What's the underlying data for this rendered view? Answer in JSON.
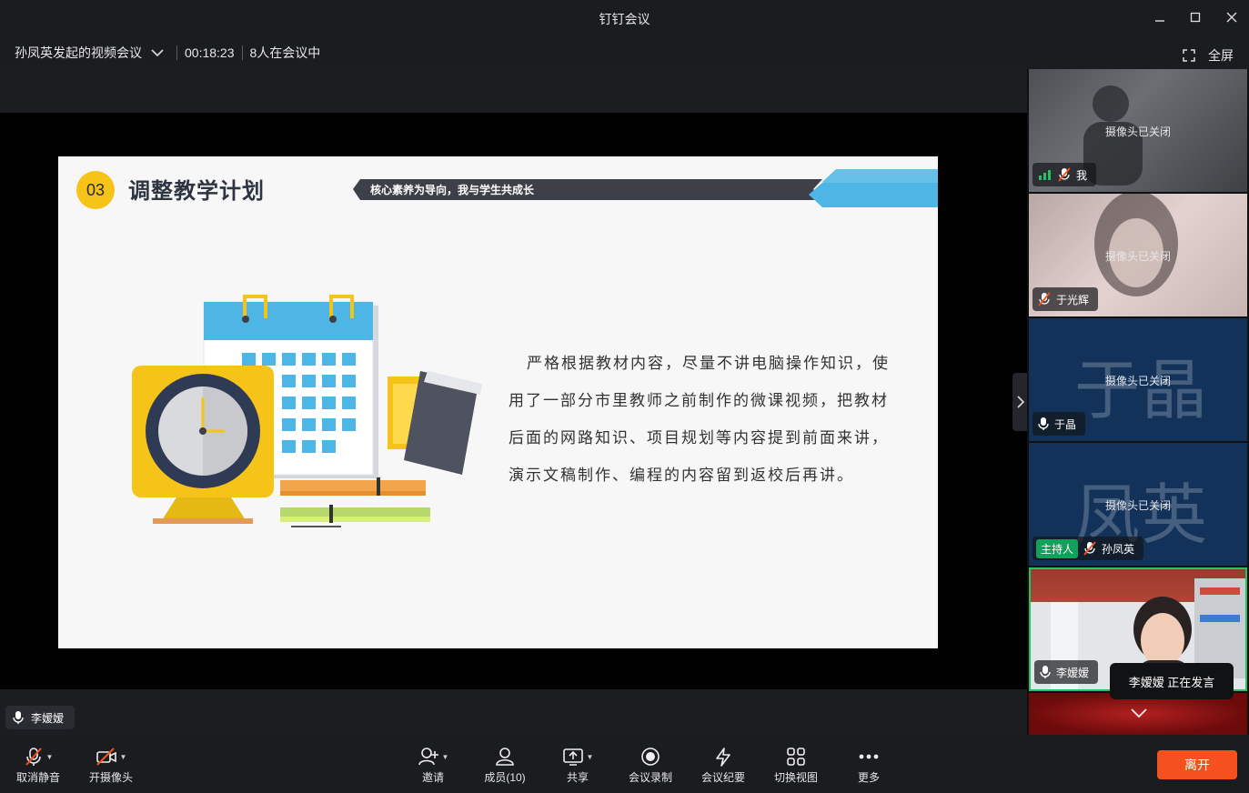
{
  "window": {
    "title": "钉钉会议"
  },
  "meeting": {
    "name": "孙凤英发起的视频会议",
    "duration": "00:18:23",
    "participants_text": "8人在会议中",
    "fullscreen_label": "全屏"
  },
  "slide": {
    "number": "03",
    "title": "调整教学计划",
    "banner_text": "核心素养为导向，我与学生共成长",
    "body": "严格根据教材内容，尽量不讲电脑操作知识，使用了一部分市里教师之前制作的微课视频，把教材后面的网路知识、项目规划等内容提到前面来讲，演示文稿制作、编程的内容留到返校后再讲。"
  },
  "participants": [
    {
      "name": "我",
      "status": "摄像头已关闭"
    },
    {
      "name": "于光辉",
      "status": "摄像头已关闭"
    },
    {
      "name": "于晶",
      "status": "摄像头已关闭",
      "watermark": "于晶"
    },
    {
      "name": "孙凤英",
      "status": "摄像头已关闭",
      "watermark": "凤英",
      "badge": "主持人"
    },
    {
      "name": "李嫒嫒"
    }
  ],
  "active_speaker": {
    "name": "李嫒嫒",
    "tip": "李嫒嫒  正在发言"
  },
  "toolbar": {
    "unmute": "取消静音",
    "camera": "开摄像头",
    "invite": "邀请",
    "members": "成员(10)",
    "share": "共享",
    "record": "会议录制",
    "minutes": "会议纪要",
    "switch_view": "切换视图",
    "more": "更多",
    "leave": "离开"
  },
  "colors": {
    "accent_green": "#12a05a",
    "leave_red": "#f4511e",
    "slide_yellow": "#f6c318",
    "slide_blue": "#4db6e4"
  }
}
